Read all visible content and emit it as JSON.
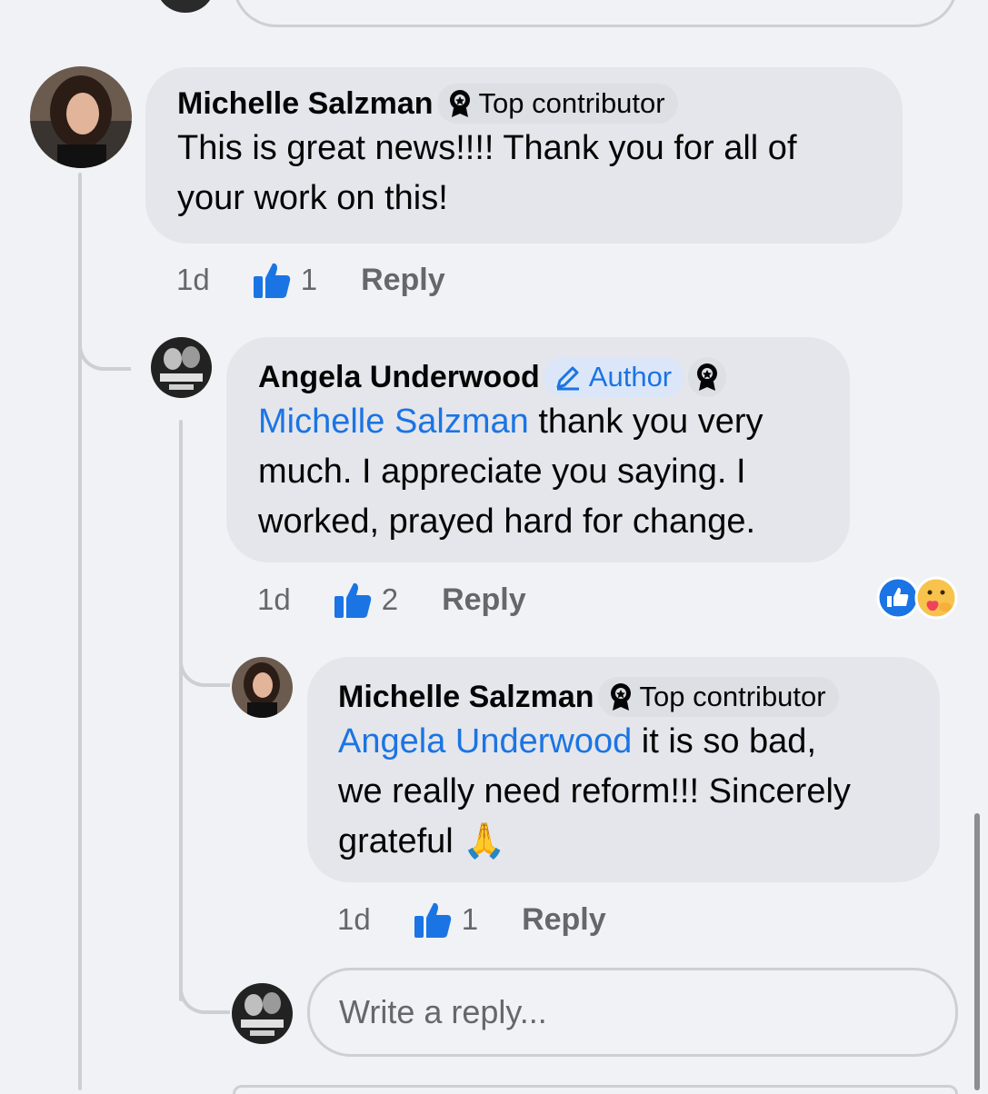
{
  "comments": [
    {
      "author": "Michelle Salzman",
      "badge": "Top contributor",
      "text": "This is great news!!!! Thank you for all of your work on this!",
      "line1": "This is great news!!!! Thank you for all of",
      "line2": "your work on this!",
      "time": "1d",
      "likes": "1",
      "reply_label": "Reply"
    },
    {
      "author": "Angela Underwood",
      "badge": "Author",
      "mention": "Michelle Salzman",
      "line1_rest": " thank you very",
      "line2": "much. I appreciate you saying. I",
      "line3": "worked, prayed hard for change.",
      "time": "1d",
      "likes": "2",
      "reply_label": "Reply",
      "reactions": [
        "like-reaction-icon",
        "care-reaction-icon"
      ]
    },
    {
      "author": "Michelle Salzman",
      "badge": "Top contributor",
      "mention": "Angela Underwood",
      "line1_rest": " it is so bad,",
      "line2": "we really need reform!!! Sincerely",
      "line3": "grateful 🙏",
      "time": "1d",
      "likes": "1",
      "reply_label": "Reply"
    }
  ],
  "reply_input": {
    "placeholder": "Write a reply..."
  },
  "colors": {
    "accent": "#1b74e4",
    "bubble": "#e4e6eb",
    "background": "#f0f2f5",
    "meta": "#65676b"
  }
}
